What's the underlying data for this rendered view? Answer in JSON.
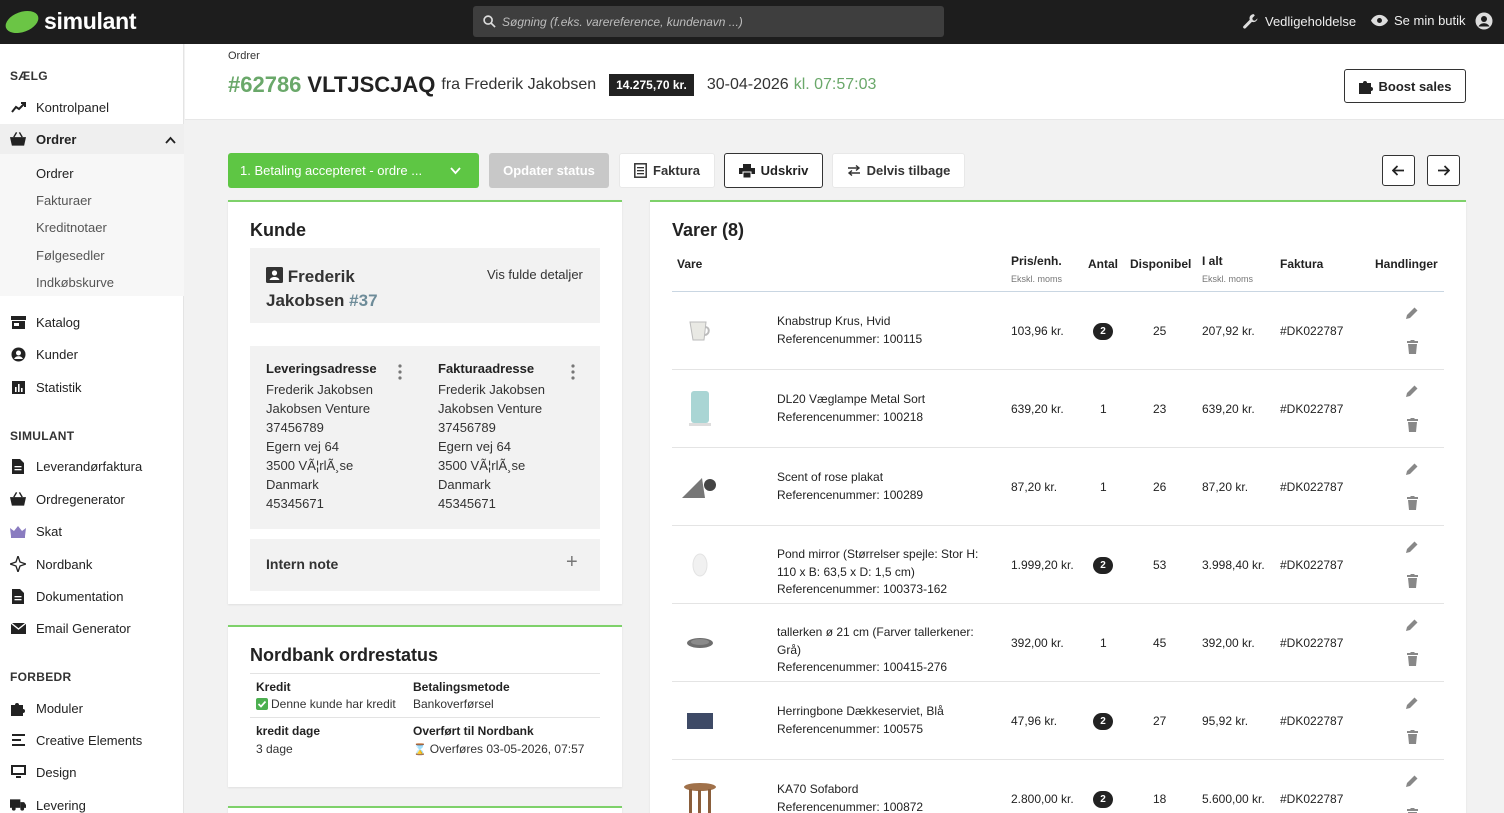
{
  "topbar": {
    "brand": "simulant",
    "search_placeholder": "Søgning (f.eks. varereference, kundenavn ...)",
    "maintenance_label": "Vedligeholdelse",
    "view_shop_label": "Se min butik"
  },
  "sidebar": {
    "sections": [
      {
        "title": "SÆLG"
      },
      {
        "title": "SIMULANT"
      },
      {
        "title": "FORBEDR"
      }
    ],
    "items": {
      "kontrolpanel": "Kontrolpanel",
      "ordrer": "Ordrer",
      "katalog": "Katalog",
      "kunder": "Kunder",
      "statistik": "Statistik",
      "leverandorfaktura": "Leverandørfaktura",
      "ordregenerator": "Ordregenerator",
      "skat": "Skat",
      "nordbank": "Nordbank",
      "dokumentation": "Dokumentation",
      "email_generator": "Email Generator",
      "moduler": "Moduler",
      "creative_elements": "Creative Elements",
      "design": "Design",
      "levering": "Levering"
    },
    "order_sub": [
      "Ordrer",
      "Fakturaer",
      "Kreditnotaer",
      "Følgesedler",
      "Indkøbskurve"
    ]
  },
  "header": {
    "breadcrumb": "Ordrer",
    "order_number": "#62786",
    "order_reference": "VLTJSCJAQ",
    "from_text": "fra Frederik Jakobsen",
    "total": "14.275,70 kr.",
    "date": "30-04-2026",
    "time": "kl. 07:57:03",
    "boost_label": "Boost sales"
  },
  "actions": {
    "status_value": "1. Betaling accepteret - ordre ...",
    "update_status": "Opdater status",
    "invoice": "Faktura",
    "print": "Udskriv",
    "partial_return": "Delvis tilbage"
  },
  "customer": {
    "title": "Kunde",
    "name_line1": "Frederik",
    "name_line2": "Jakobsen",
    "id": "#37",
    "details_link": "Vis fulde detaljer",
    "delivery": {
      "heading": "Leveringsadresse",
      "lines": [
        "Frederik Jakobsen",
        "Jakobsen Venture",
        "37456789",
        "Egern vej 64",
        "3500 VÃ¦rlÃ¸se",
        "Danmark",
        "45345671"
      ]
    },
    "billing": {
      "heading": "Fakturaadresse",
      "lines": [
        "Frederik Jakobsen",
        "Jakobsen Venture",
        "37456789",
        "Egern vej 64",
        "3500 VÃ¦rlÃ¸se",
        "Danmark",
        "45345671"
      ]
    },
    "note_title": "Intern note"
  },
  "nordbank": {
    "title": "Nordbank ordrestatus",
    "credit_label": "Kredit",
    "credit_value": "Denne kunde har kredit",
    "payment_label": "Betalingsmetode",
    "payment_value": "Bankoverførsel",
    "days_label": "kredit dage",
    "days_value": "3 dage",
    "transfer_label": "Overført til Nordbank",
    "transfer_value": "Overføres 03-05-2026, 07:57"
  },
  "items": {
    "title": "Varer (8)",
    "headers": {
      "product": "Vare",
      "price": "Pris/enh.",
      "price_sub": "Ekskl. moms",
      "qty": "Antal",
      "available": "Disponibel",
      "total": "I alt",
      "total_sub": "Ekskl. moms",
      "invoice": "Faktura",
      "actions": "Handlinger"
    },
    "rows": [
      {
        "name": "Knabstrup Krus, Hvid",
        "ref": "Referencenummer: 100115",
        "price": "103,96 kr.",
        "qty": "2",
        "qty_badge": true,
        "available": "25",
        "total": "207,92 kr.",
        "invoice": "#DK022787",
        "img": "mug"
      },
      {
        "name": "DL20 Væglampe Metal Sort",
        "ref": "Referencenummer: 100218",
        "price": "639,20 kr.",
        "qty": "1",
        "qty_badge": false,
        "available": "23",
        "total": "639,20 kr.",
        "invoice": "#DK022787",
        "img": "lamp"
      },
      {
        "name": "Scent of rose plakat",
        "ref": "Referencenummer: 100289",
        "price": "87,20 kr.",
        "qty": "1",
        "qty_badge": false,
        "available": "26",
        "total": "87,20 kr.",
        "invoice": "#DK022787",
        "img": "poster"
      },
      {
        "name": "Pond mirror (Størrelser spejle: Stor H:",
        "name2": "110 x B: 63,5 x D: 1,5 cm)",
        "ref": "Referencenummer: 100373-162",
        "price": "1.999,20 kr.",
        "qty": "2",
        "qty_badge": true,
        "available": "53",
        "total": "3.998,40 kr.",
        "invoice": "#DK022787",
        "img": "mirror"
      },
      {
        "name": "tallerken ø 21 cm (Farver tallerkener:",
        "name2": "Grå)",
        "ref": "Referencenummer: 100415-276",
        "price": "392,00 kr.",
        "qty": "1",
        "qty_badge": false,
        "available": "45",
        "total": "392,00 kr.",
        "invoice": "#DK022787",
        "img": "plate"
      },
      {
        "name": "Herringbone Dækkeserviet, Blå",
        "ref": "Referencenummer: 100575",
        "price": "47,96 kr.",
        "qty": "2",
        "qty_badge": true,
        "available": "27",
        "total": "95,92 kr.",
        "invoice": "#DK022787",
        "img": "mat"
      },
      {
        "name": "KA70 Sofabord",
        "ref": "Referencenummer: 100872",
        "price": "2.800,00 kr.",
        "qty": "2",
        "qty_badge": true,
        "available": "18",
        "total": "5.600,00 kr.",
        "invoice": "#DK022787",
        "img": "table"
      }
    ]
  },
  "colors": {
    "accent_green": "#5ec644",
    "topbar": "#1d1d1d"
  }
}
